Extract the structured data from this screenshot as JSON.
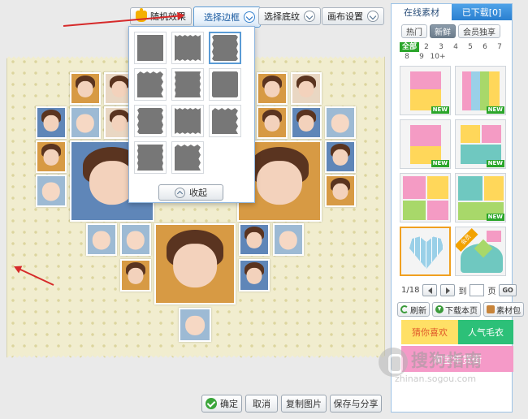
{
  "toolbar": {
    "random_effect": "随机效果",
    "choose_frame": "选择边框",
    "choose_texture": "选择底纹",
    "canvas_settings": "画布设置"
  },
  "frame_panel": {
    "collapse": "收起",
    "selected_index": 2
  },
  "bottom": {
    "confirm": "确定",
    "cancel": "取消",
    "copy_image": "复制图片",
    "save_share": "保存与分享"
  },
  "right_panel": {
    "tabs": [
      "在线素材",
      "已下载[0]"
    ],
    "filters": [
      "热门",
      "新鲜",
      "会员独享"
    ],
    "active_filter": 1,
    "page_links": [
      "全部",
      "2",
      "3",
      "4",
      "5",
      "6",
      "7",
      "8",
      "9",
      "10+"
    ],
    "templates": [
      {
        "badge": "NEW"
      },
      {
        "badge": "NEW"
      },
      {
        "badge": "NEW"
      },
      {
        "badge": "NEW"
      },
      {
        "badge": ""
      },
      {
        "badge": "NEW"
      },
      {
        "badge": ""
      },
      {
        "badge": "会员"
      }
    ],
    "pager": {
      "current": "1/18",
      "goto": "到",
      "page_suffix": "页",
      "go": "GO"
    },
    "actions": {
      "refresh": "刷新",
      "download_page": "下载本页",
      "material_pack": "素材包"
    },
    "banner": {
      "left": "猜你喜欢",
      "right": "人气毛衣",
      "bottom": "淘宝年货街"
    }
  },
  "watermark": {
    "name": "搜狗指南",
    "url": "zhinan.sogou.com"
  },
  "colors": {
    "accent": "#2a7fd0",
    "arrow": "#d62a2a",
    "new_badge": "#2aa52a",
    "selected_template": "#f0a020"
  }
}
